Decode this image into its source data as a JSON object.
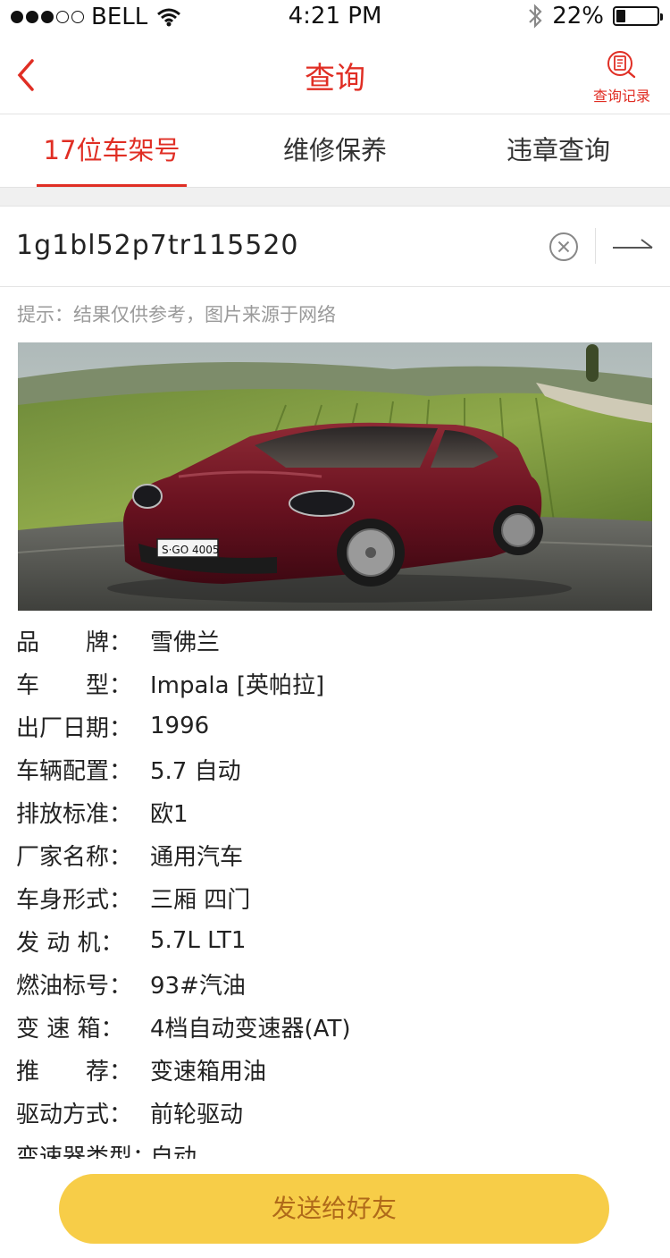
{
  "status_bar": {
    "carrier": "BELL",
    "time": "4:21 PM",
    "battery_percent": "22%",
    "battery_level": 0.22,
    "signal_dots_filled": 3,
    "signal_dots_total": 5,
    "icons": [
      "signal-dots-icon",
      "wifi-icon",
      "bluetooth-icon",
      "battery-icon"
    ]
  },
  "nav": {
    "title": "查询",
    "history_label": "查询记录",
    "back_icon": "chevron-left-icon",
    "history_icon": "document-search-icon"
  },
  "tabs": [
    {
      "label": "17位车架号",
      "active": true
    },
    {
      "label": "维修保养",
      "active": false
    },
    {
      "label": "违章查询",
      "active": false
    }
  ],
  "search": {
    "value": "1g1bl52p7tr115520",
    "clear_icon": "clear-circle-icon",
    "submit_icon": "arrow-right-icon"
  },
  "hint": "提示：结果仅供参考，图片来源于网络",
  "car": {
    "plate_text": "S·GO 4005"
  },
  "info": [
    {
      "label": "品　　牌：",
      "value": "雪佛兰"
    },
    {
      "label": "车　　型：",
      "value": " Impala [英帕拉]"
    },
    {
      "label": "出厂日期：",
      "value": "1996"
    },
    {
      "label": "车辆配置：",
      "value": " 5.7 自动"
    },
    {
      "label": "排放标准：",
      "value": " 欧1"
    },
    {
      "label": "厂家名称：",
      "value": " 通用汽车"
    },
    {
      "label": "车身形式：",
      "value": " 三厢 四门"
    },
    {
      "label": "发 动 机：",
      "value": " 5.7L LT1"
    },
    {
      "label": "燃油标号：",
      "value": " 93#汽油"
    },
    {
      "label": "变 速 箱：",
      "value": " 4档自动变速器(AT)"
    },
    {
      "label": "推　　荐：",
      "value": " 变速箱用油"
    },
    {
      "label": "驱动方式：",
      "value": " 前轮驱动"
    },
    {
      "label": "变速器类型：",
      "value": "自动"
    }
  ],
  "send_button": "发送给好友",
  "colors": {
    "accent_red": "#e02e24",
    "button_yellow": "#f7cd48",
    "button_text": "#b06a1a",
    "hint_gray": "#9a9a9a"
  }
}
